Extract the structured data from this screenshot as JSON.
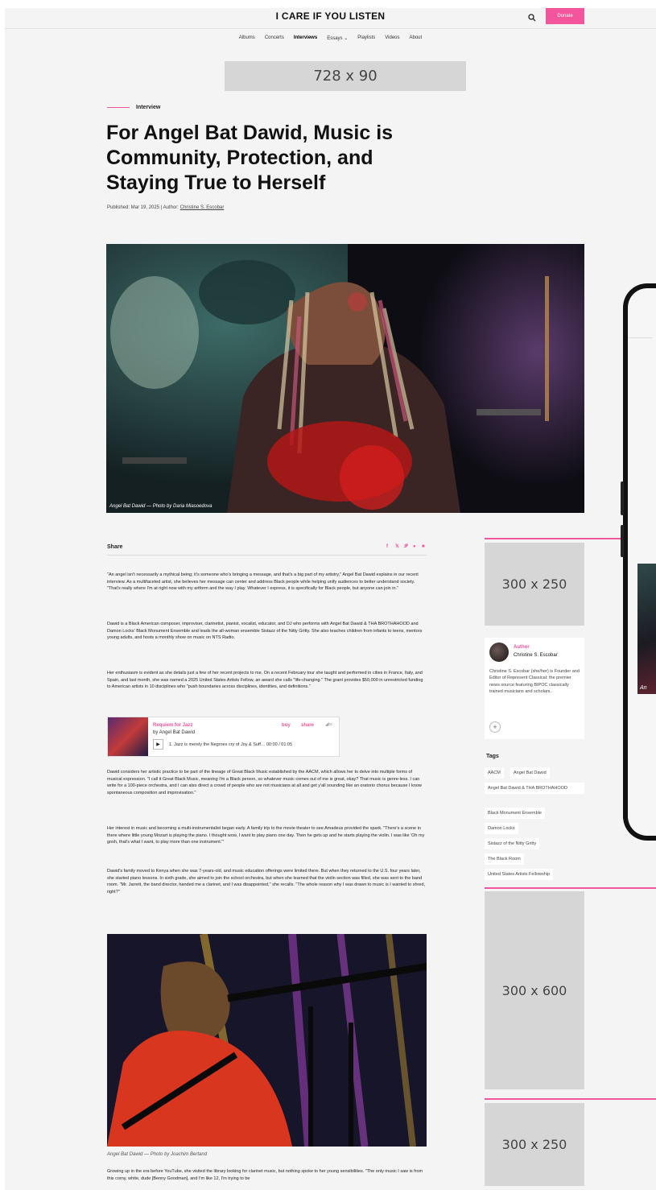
{
  "header": {
    "brand": "I CARE IF YOU LISTEN",
    "donate_label": "Donate",
    "nav": [
      "Albums",
      "Concerts",
      "Interviews",
      "Essays ⌄",
      "Playlists",
      "Videos",
      "About"
    ]
  },
  "ads": {
    "leaderboard": "728 x 90",
    "rect_a": "300 x 250",
    "skyscraper": "300 x 600",
    "rect_b": "300 x 250"
  },
  "article": {
    "kicker": "Interview",
    "title": "For Angel Bat Dawid, Music is Community, Protection, and Staying True to Herself",
    "published_prefix": "Published: Mar 19, 2025 | Author: ",
    "author_link": "Christine S. Escobar",
    "hero_caption": "Angel Bat Dawid — Photo by Daria Miasoedova",
    "share_label": "Share",
    "paragraphs": [
      "\"An angel isn't necessarily a mythical being; it's someone who's bringing a message, and that's a big part of my artistry,\" Angel Bat Dawid explains in our recent interview. As a multifaceted artist, she believes her message can center and address Black people while helping unify audiences to better understand society. \"That's really where I'm at right now with my artform and the way I play. Whatever I express, it is specifically for Black people, but anyone can join in.\"",
      "Dawid is a Black American composer, improviser, clarinetist, pianist, vocalist, educator, and DJ who performs with Angel Bat Dawid & THA BROTHAHOOD and Damon Locks' Black Monument Ensemble and leads the all-woman ensemble Sistazz of the Nitty Gritty. She also teaches children from infants to teens, mentors young adults, and hosts a monthly show on music on NTS Radio.",
      "Her enthusiasm is evident as she details just a few of her recent projects to me. On a recent February tour she taught and performed in cities in France, Italy, and Spain, and last month, she was named a 2025 United States Artists Fellow, an award she calls \"life-changing.\" The grant provides $50,000 in unrestricted funding to American artists in 10 disciplines who \"push boundaries across disciplines, identities, and definitions.\"",
      "Dawid considers her artistic practice to be part of the lineage of Great Black Music established by the AACM, which allows her to delve into multiple forms of musical expression. \"I call it Great Black Music, meaning I'm a Black person, so whatever music comes out of me is great, okay? That music is genre-less. I can write for a 100-piece orchestra, and I can also direct a crowd of people who are not musicians at all and get y'all sounding like an oratorio chorus because I know spontaneous composition and improvisation.\"",
      "Her interest in music and becoming a multi-instrumentalist began early. A family trip to the movie theater to see Amadeus provided the spark. \"There's a scene in there where little young Mozart is playing the piano. I thought wow, I want to play piano one day. Then he gets up and he starts playing the violin. I was like 'Oh my gosh, that's what I want, to play more than one instrument.'\"",
      "Dawid's family moved to Kenya when she was 7-years-old, and music education offerings were limited there. But when they returned to the U.S. four years later, she started piano lessons. In sixth grade, she aimed to join the school orchestra, but when she learned that the violin section was filled, she was sent to the band room. \"Mr. Jarrett, the band director, handed me a clarinet, and I was disappointed,\" she recalls. \"The whole reason why I was drawn to music is I wanted to shred, right?\"",
      "Growing up in the era before YouTube, she visited the library looking for clarinet music, but nothing spoke to her young sensibilities. \"The only music I saw is from this corny, white, dude [Benny Goodman], and I'm like 12, I'm trying to be"
    ],
    "photo2_caption": "Angel Bat Dawid — Photo by Joachim Bertand"
  },
  "player": {
    "title": "Requiem for Jazz",
    "artist": "by Angel Bat Dawid",
    "buy": "buy",
    "share": "share",
    "brand": "◢bc",
    "track": "1.  Jazz is merely the Negroes cry of Joy & Suff…  00:00 / 01:05"
  },
  "sidebar": {
    "author_label": "Author",
    "author_name": "Christine S. Escobar",
    "author_bio": "Christine S. Escobar (she/her) is Founder and Editor of Represent Classical: the premier news source featuring BIPOC classically trained musicians and scholars.",
    "plus": "+",
    "tags_heading": "Tags",
    "tags": [
      "AACM",
      "Angel Bat Dawid",
      "Angel Bat Dawid & THA BROTHAHOOD",
      "Black Monument Ensemble",
      "Damon Locks",
      "Sistazz of the Nitty Gritty",
      "The Black Room",
      "United States Artists Fellowship"
    ]
  },
  "phone": {
    "caption_fragment": "An"
  },
  "colors": {
    "accent": "#f2559b",
    "ad_gray": "#d6d6d6"
  }
}
